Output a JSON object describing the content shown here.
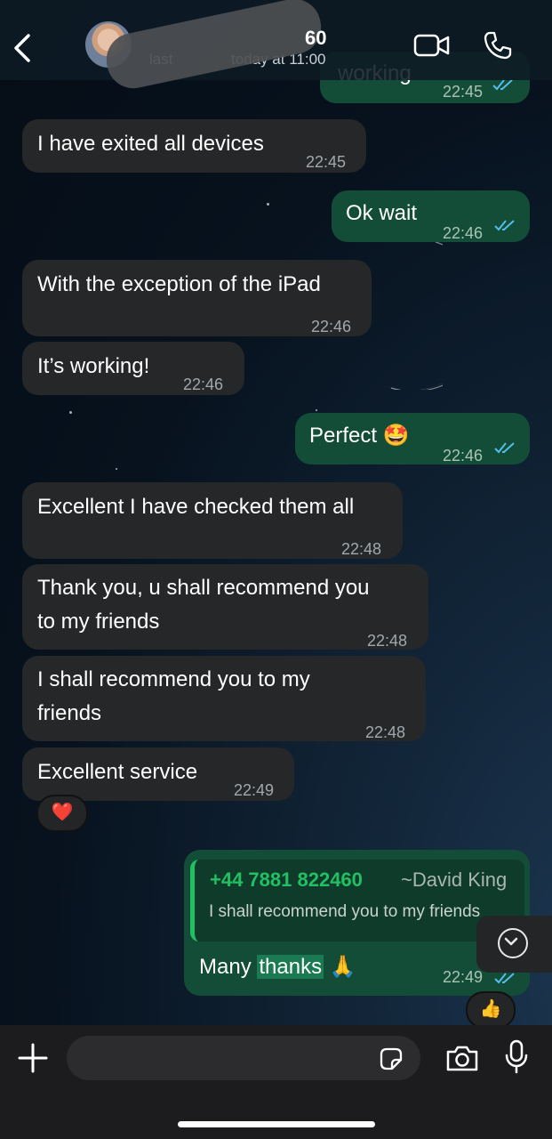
{
  "header": {
    "contact_name": "60",
    "status_part1": "last",
    "status_part2": "today at 11:00"
  },
  "messages": [
    {
      "dir": "out",
      "text": "working",
      "time": "22:45",
      "ticks": "read"
    },
    {
      "dir": "in",
      "text": "I have exited all devices",
      "time": "22:45"
    },
    {
      "dir": "out",
      "text": "Ok wait",
      "time": "22:46",
      "ticks": "read"
    },
    {
      "dir": "in",
      "text": "With the exception of the iPad",
      "time": "22:46"
    },
    {
      "dir": "in",
      "text": "It’s working!",
      "time": "22:46"
    },
    {
      "dir": "out",
      "text": "Perfect 🤩",
      "time": "22:46",
      "ticks": "read"
    },
    {
      "dir": "in",
      "text": "Excellent I have checked them all",
      "time": "22:48"
    },
    {
      "dir": "in",
      "text_line1": "Thank you, u shall recommend you",
      "text_line2": "to my friends",
      "time": "22:48"
    },
    {
      "dir": "in",
      "text_line1": "I shall recommend you to my",
      "text_line2": "friends",
      "time": "22:48"
    },
    {
      "dir": "in",
      "text": "Excellent service",
      "time": "22:49",
      "reaction": "❤️"
    },
    {
      "dir": "out",
      "quote": {
        "phone": "+44 7881 822460",
        "author": "~David King",
        "text": "I shall recommend you to my friends"
      },
      "text_plain": "Many ",
      "text_highlight": "thanks",
      "text_emoji": "🙏",
      "time": "22:49",
      "ticks": "read",
      "reaction": "👍"
    }
  ],
  "colors": {
    "incoming": "#252728",
    "outgoing": "#134d37",
    "accent": "#21c063",
    "read_ticks": "#53bdeb"
  },
  "icons": [
    "back-chevron-icon",
    "video-call-icon",
    "voice-call-icon",
    "scroll-down-icon",
    "attach-plus-icon",
    "sticker-icon",
    "camera-icon",
    "microphone-icon"
  ]
}
